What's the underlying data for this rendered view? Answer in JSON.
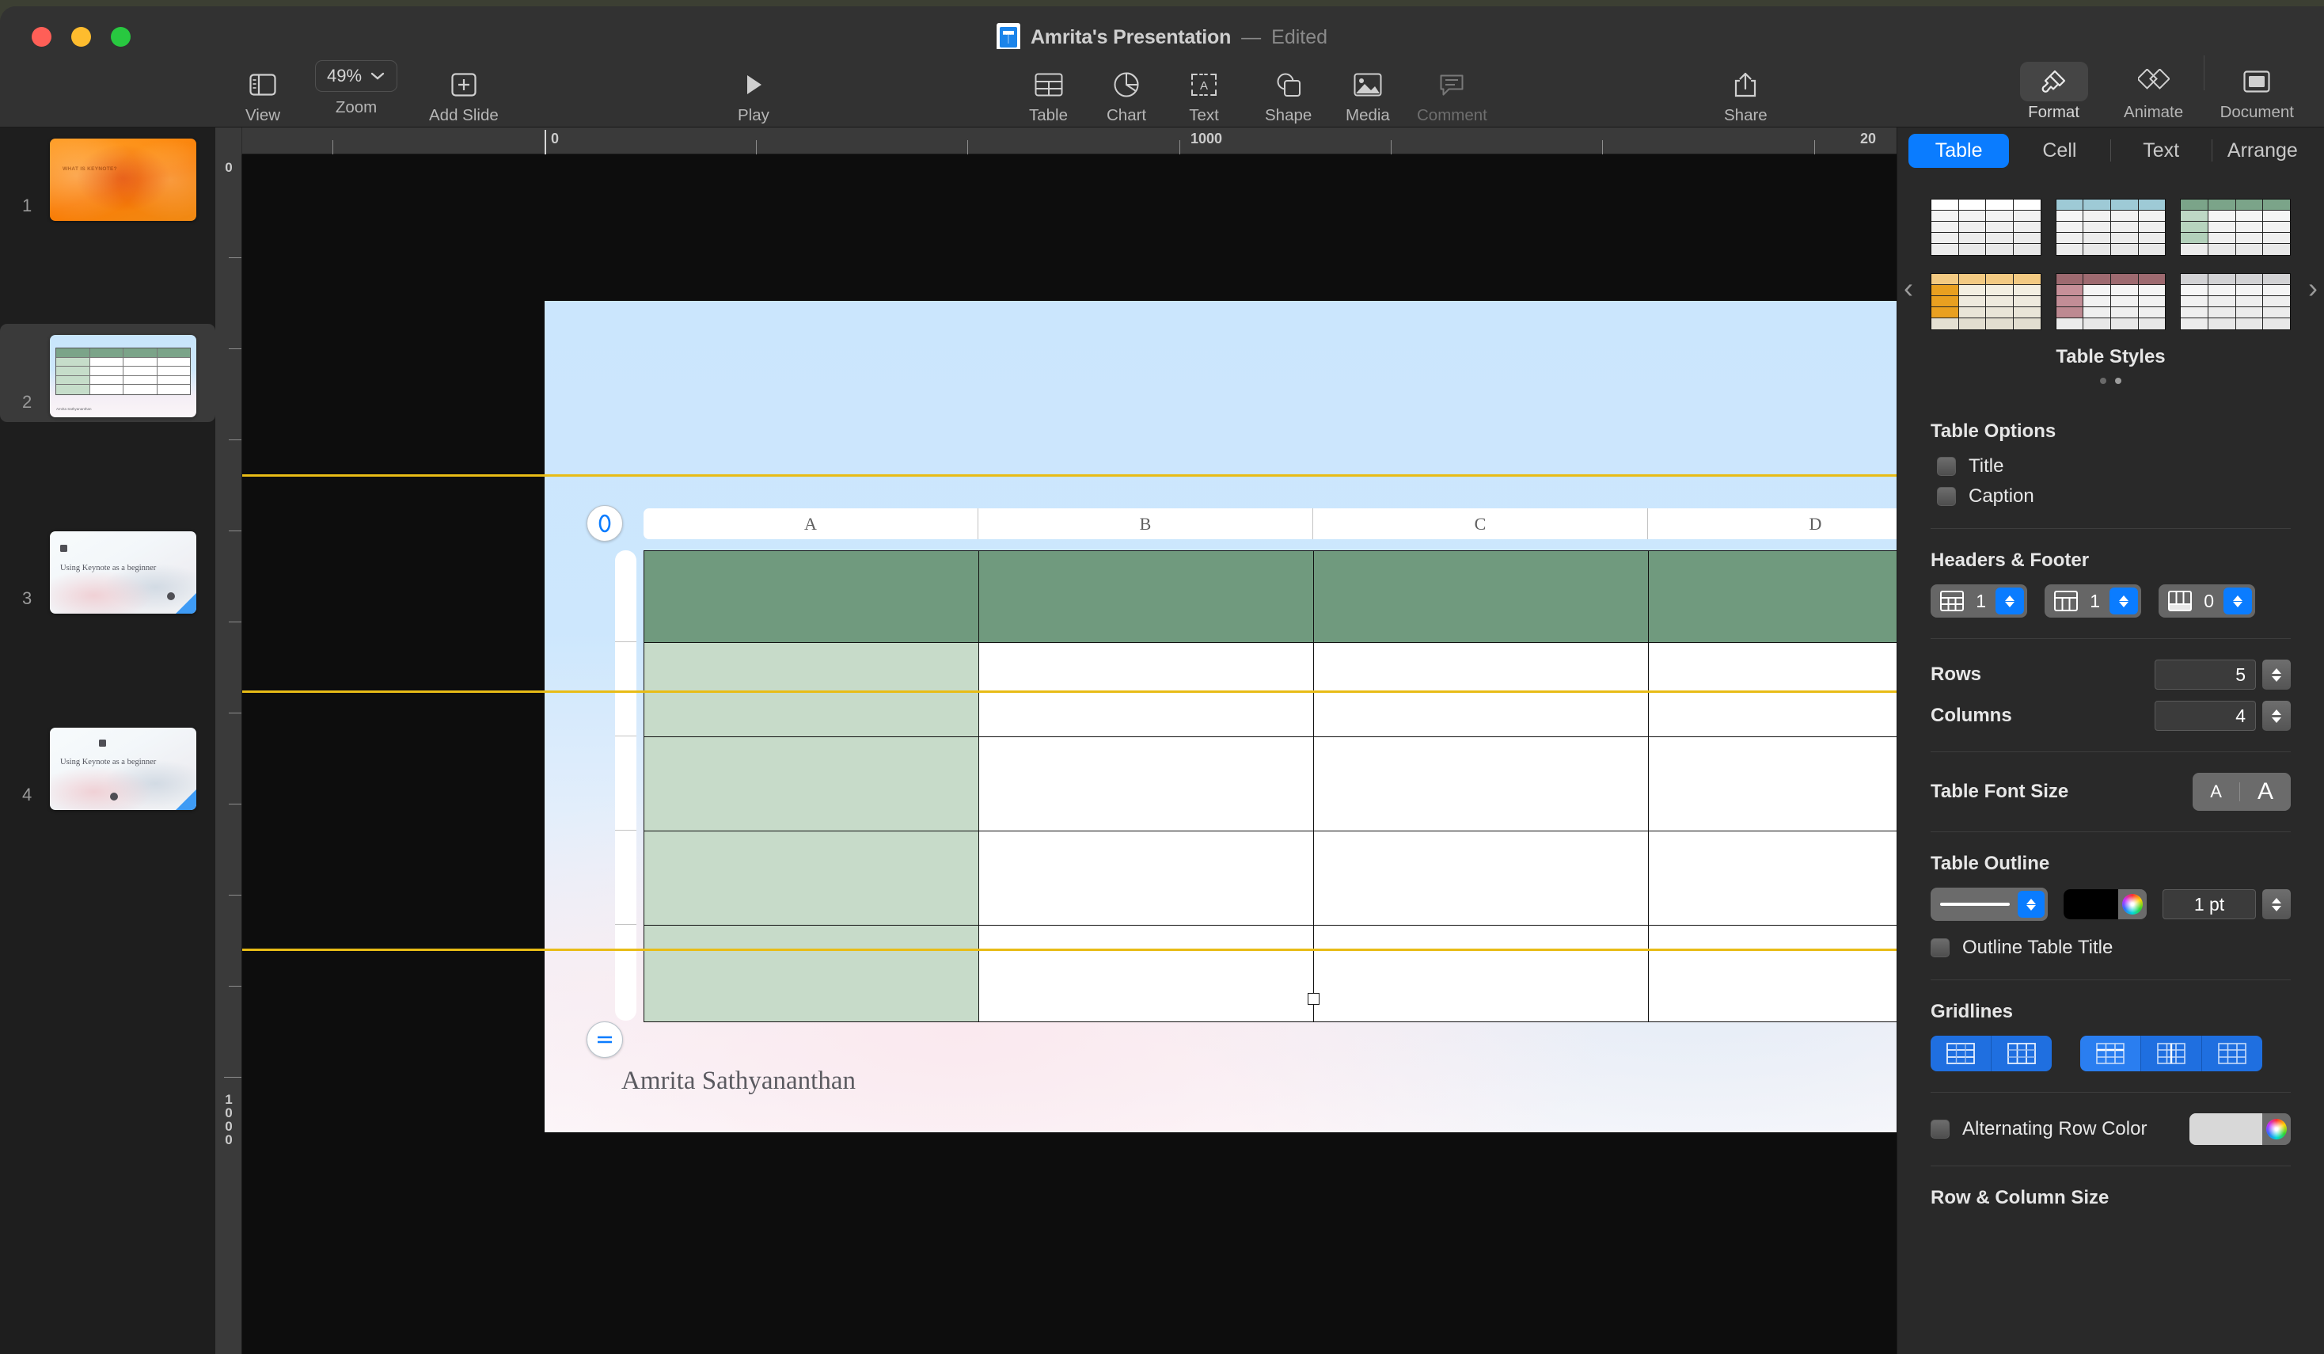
{
  "window": {
    "title": "Amrita's Presentation",
    "separator": "—",
    "status": "Edited"
  },
  "toolbar": {
    "view_label": "View",
    "zoom_label": "Zoom",
    "zoom_value": "49%",
    "add_slide_label": "Add Slide",
    "play_label": "Play",
    "table_label": "Table",
    "chart_label": "Chart",
    "text_label": "Text",
    "shape_label": "Shape",
    "media_label": "Media",
    "comment_label": "Comment",
    "share_label": "Share",
    "format_label": "Format",
    "animate_label": "Animate",
    "document_label": "Document"
  },
  "navigator": {
    "slides": [
      {
        "number": "1",
        "title": "WHAT IS KEYNOTE?"
      },
      {
        "number": "2",
        "title": "Amrita Sathyananthan"
      },
      {
        "number": "3",
        "title": "Using Keynote as a beginner"
      },
      {
        "number": "4",
        "title": "Using Keynote as a beginner"
      }
    ]
  },
  "canvas": {
    "ruler_h_start": "0",
    "ruler_h_mid": "1000",
    "ruler_h_end": "20",
    "ruler_v_start": "0",
    "ruler_v_end": "1000"
  },
  "slide": {
    "author_text": "Amrita Sathyananthan",
    "table": {
      "column_headers": [
        "A",
        "B",
        "C",
        "D"
      ],
      "rows": 5,
      "columns": 4,
      "header_row_color": "#709a7e",
      "header_column_color": "#c7dbc9"
    }
  },
  "inspector": {
    "tabs": [
      {
        "label": "Table",
        "active": true
      },
      {
        "label": "Cell",
        "active": false
      },
      {
        "label": "Text",
        "active": false
      },
      {
        "label": "Arrange",
        "active": false
      }
    ],
    "table_styles": {
      "label": "Table Styles",
      "page": 1,
      "pages": 2,
      "prev_arrow": "‹",
      "next_arrow": "›",
      "styles": [
        {
          "name": "plain-white",
          "header": "#ffffff",
          "column": "#f5f5f5",
          "body": "#efefef"
        },
        {
          "name": "blue",
          "header": "#9ecad6",
          "column": "#f5f5f5",
          "body": "#efefef"
        },
        {
          "name": "green",
          "header": "#7ba489",
          "column": "#bed8c5",
          "body": "#f2f2f2"
        },
        {
          "name": "orange",
          "header": "#f3ca82",
          "column": "#e9a020",
          "body": "#efe9da"
        },
        {
          "name": "maroon",
          "header": "#9e6a70",
          "column": "#c79099",
          "body": "#f2f2f2"
        },
        {
          "name": "gray",
          "header": "#d2d2d4",
          "column": "#f7f7f7",
          "body": "#efefef"
        }
      ]
    },
    "table_options": {
      "title": "Table Options",
      "checkboxes": [
        {
          "label": "Title",
          "checked": false
        },
        {
          "label": "Caption",
          "checked": false
        }
      ]
    },
    "headers_footer": {
      "title": "Headers & Footer",
      "header_rows": "1",
      "header_columns": "1",
      "footer_rows": "0"
    },
    "rows_columns": {
      "rows_label": "Rows",
      "rows_value": "5",
      "columns_label": "Columns",
      "columns_value": "4"
    },
    "font_size": {
      "label": "Table Font Size",
      "decrease": "A",
      "increase": "A"
    },
    "table_outline": {
      "label": "Table Outline",
      "color": "#000000",
      "width": "1 pt",
      "outline_title_label": "Outline Table Title",
      "outline_title_checked": false
    },
    "gridlines": {
      "label": "Gridlines"
    },
    "alternating": {
      "label": "Alternating Row Color",
      "checked": false,
      "color": "#d8d8d8"
    },
    "row_column_size": {
      "label": "Row & Column Size"
    }
  }
}
